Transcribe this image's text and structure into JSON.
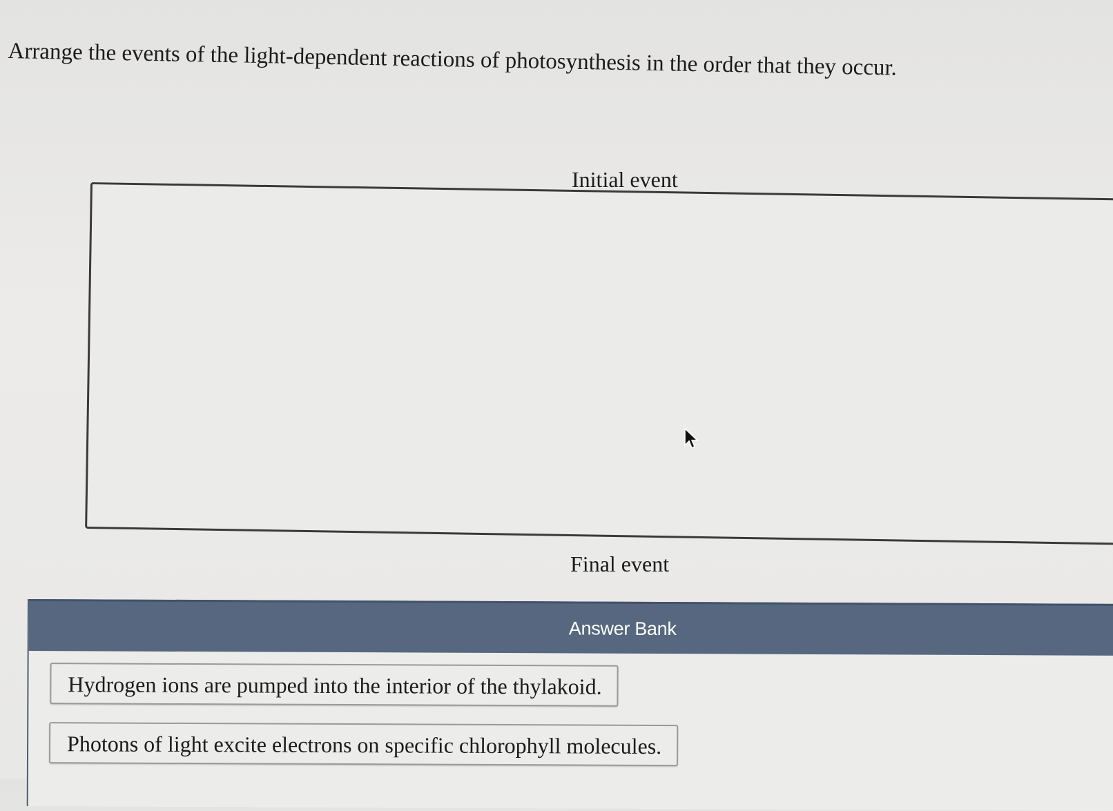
{
  "question": {
    "prompt": "Arrange the events of the light-dependent reactions of photosynthesis in the order that they occur."
  },
  "ordering": {
    "initial_label": "Initial event",
    "final_label": "Final event"
  },
  "answer_bank": {
    "title": "Answer Bank",
    "items": [
      {
        "text": "Hydrogen ions are pumped into the interior of the thylakoid."
      },
      {
        "text": "Photons of light excite electrons on specific chlorophyll molecules."
      }
    ]
  },
  "colors": {
    "answer_bank_header": "#56677f",
    "page_background": "#e9e9e7"
  },
  "icons": {
    "cursor": "mouse-pointer-icon"
  }
}
